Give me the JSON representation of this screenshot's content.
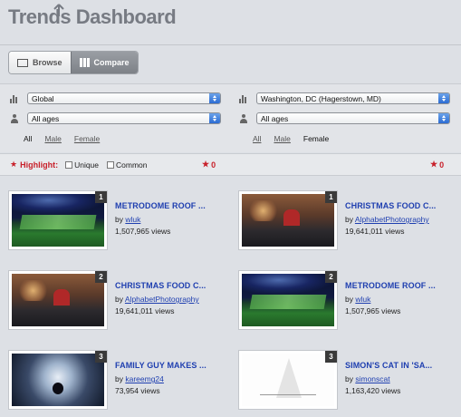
{
  "app": {
    "title": "Trends Dashboard"
  },
  "view_toggle": {
    "browse_label": "Browse",
    "compare_label": "Compare",
    "active": "compare"
  },
  "left": {
    "region": "Global",
    "age": "All ages",
    "gender_options": [
      "All",
      "Male",
      "Female"
    ],
    "gender_selected": "All",
    "highlight_count": "0"
  },
  "right": {
    "region": "Washington, DC (Hagerstown, MD)",
    "age": "All ages",
    "gender_options": [
      "All",
      "Male",
      "Female"
    ],
    "gender_selected": "Female",
    "highlight_count": "0"
  },
  "highlight": {
    "label": "Highlight:",
    "unique_label": "Unique",
    "common_label": "Common",
    "star": "★"
  },
  "left_videos": [
    {
      "rank": "1",
      "title": "METRODOME ROOF ...",
      "by": "by",
      "author": "wluk",
      "views": "1,507,965 views",
      "thumb": "stadium"
    },
    {
      "rank": "2",
      "title": "CHRISTMAS FOOD C...",
      "by": "by",
      "author": "AlphabetPhotography",
      "views": "19,641,011 views",
      "thumb": "mall"
    },
    {
      "rank": "3",
      "title": "FAMILY GUY MAKES ...",
      "by": "by",
      "author": "kareemg24",
      "views": "73,954 views",
      "thumb": "tunnel"
    }
  ],
  "right_videos": [
    {
      "rank": "1",
      "title": "CHRISTMAS FOOD C...",
      "by": "by",
      "author": "AlphabetPhotography",
      "views": "19,641,011 views",
      "thumb": "mall"
    },
    {
      "rank": "2",
      "title": "METRODOME ROOF ...",
      "by": "by",
      "author": "wluk",
      "views": "1,507,965 views",
      "thumb": "stadium"
    },
    {
      "rank": "3",
      "title": "SIMON'S CAT IN 'SA...",
      "by": "by",
      "author": "simonscat",
      "views": "1,163,420 views",
      "thumb": "sketch"
    }
  ]
}
